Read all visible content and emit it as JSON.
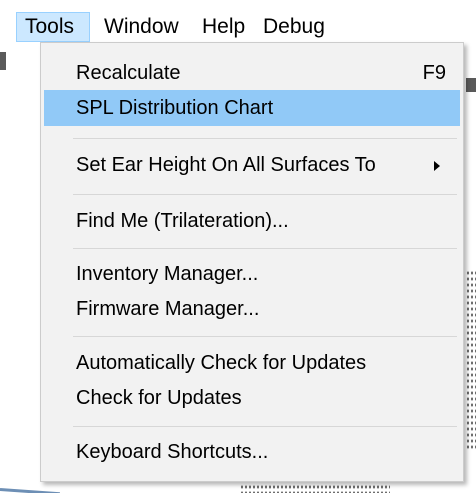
{
  "menubar": {
    "items": [
      {
        "label": "Tools"
      },
      {
        "label": "Window"
      },
      {
        "label": "Help"
      },
      {
        "label": "Debug"
      }
    ]
  },
  "tools_menu": {
    "recalculate": {
      "label": "Recalculate",
      "shortcut": "F9"
    },
    "spl_distribution": {
      "label": "SPL Distribution Chart"
    },
    "set_ear_height": {
      "label": "Set Ear Height On All Surfaces To",
      "has_submenu": true
    },
    "find_me": {
      "label": "Find Me (Trilateration)..."
    },
    "inventory_manager": {
      "label": "Inventory Manager..."
    },
    "firmware_manager": {
      "label": "Firmware Manager..."
    },
    "auto_check_updates": {
      "label": "Automatically Check for Updates"
    },
    "check_updates": {
      "label": "Check for Updates"
    },
    "keyboard_shortcuts": {
      "label": "Keyboard Shortcuts..."
    }
  },
  "colors": {
    "menubar_active_bg": "#cce8ff",
    "menu_highlight_bg": "#91c9f7",
    "menu_bg": "#f2f2f2"
  },
  "icons": {
    "submenu": "chevron-right-icon"
  }
}
